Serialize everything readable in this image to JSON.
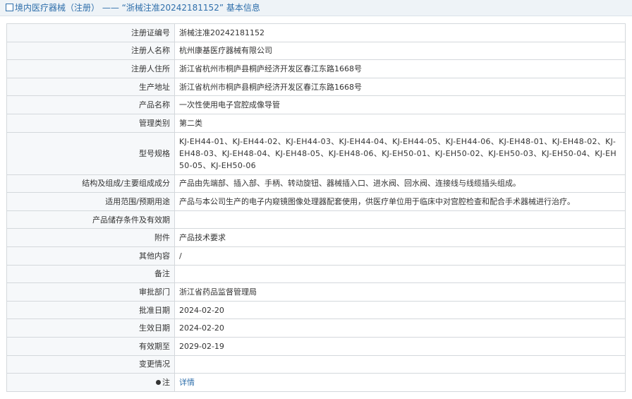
{
  "header": {
    "title": "境内医疗器械（注册） —— “浙械注准20242181152” 基本信息"
  },
  "rows": [
    {
      "label": "注册证编号",
      "value": "浙械注准20242181152"
    },
    {
      "label": "注册人名称",
      "value": "杭州康基医疗器械有限公司"
    },
    {
      "label": "注册人住所",
      "value": "浙江省杭州市桐庐县桐庐经济开发区春江东路1668号"
    },
    {
      "label": "生产地址",
      "value": "浙江省杭州市桐庐县桐庐经济开发区春江东路1668号"
    },
    {
      "label": "产品名称",
      "value": "一次性使用电子宫腔成像导管"
    },
    {
      "label": "管理类别",
      "value": "第二类"
    },
    {
      "label": "型号规格",
      "value": "KJ-EH44-01、KJ-EH44-02、KJ-EH44-03、KJ-EH44-04、KJ-EH44-05、KJ-EH44-06、KJ-EH48-01、KJ-EH48-02、KJ-EH48-03、KJ-EH48-04、KJ-EH48-05、KJ-EH48-06、KJ-EH50-01、KJ-EH50-02、KJ-EH50-03、KJ-EH50-04、KJ-EH50-05、KJ-EH50-06"
    },
    {
      "label": "结构及组成/主要组成成分",
      "value": "产品由先端部、插入部、手柄、转动旋钮、器械插入口、进水阀、回水阀、连接线与线缆插头组成。"
    },
    {
      "label": "适用范围/预期用途",
      "value": "产品与本公司生产的电子内窥镜图像处理器配套使用，供医疗单位用于临床中对宫腔检查和配合手术器械进行治疗。"
    },
    {
      "label": "产品储存条件及有效期",
      "value": ""
    },
    {
      "label": "附件",
      "value": "产品技术要求"
    },
    {
      "label": "其他内容",
      "value": "/"
    },
    {
      "label": "备注",
      "value": ""
    },
    {
      "label": "审批部门",
      "value": "浙江省药品监督管理局"
    },
    {
      "label": "批准日期",
      "value": "2024-02-20"
    },
    {
      "label": "生效日期",
      "value": "2024-02-20"
    },
    {
      "label": "有效期至",
      "value": "2029-02-19"
    },
    {
      "label": "变更情况",
      "value": ""
    }
  ],
  "note": {
    "label": "注",
    "link_text": "详情",
    "icon": "bulb-icon"
  }
}
